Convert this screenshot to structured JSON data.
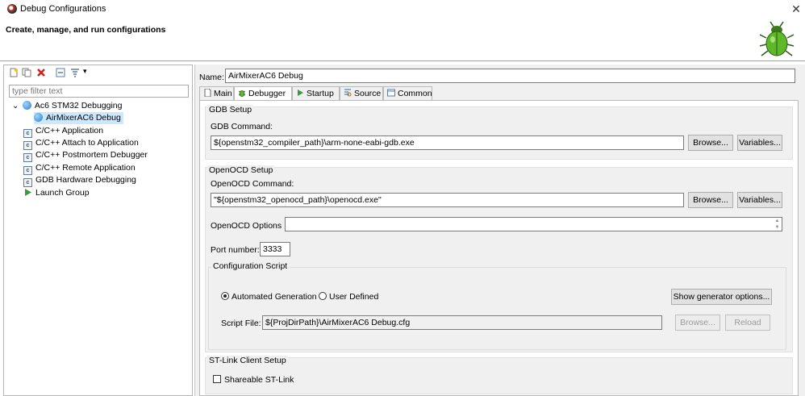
{
  "window": {
    "title": "Debug Configurations",
    "close": "✕"
  },
  "header": {
    "description": "Create, manage, and run configurations"
  },
  "left": {
    "filter_placeholder": "type filter text",
    "tree": [
      {
        "label": "Ac6 STM32 Debugging",
        "icon": "globe-icon",
        "expanded": true
      },
      {
        "label": "AirMixerAC6 Debug",
        "icon": "globe-icon",
        "selected": true
      },
      {
        "label": "C/C++ Application",
        "icon": "c-icon"
      },
      {
        "label": "C/C++ Attach to Application",
        "icon": "c-icon"
      },
      {
        "label": "C/C++ Postmortem Debugger",
        "icon": "c-icon"
      },
      {
        "label": "C/C++ Remote Application",
        "icon": "c-icon"
      },
      {
        "label": "GDB Hardware Debugging",
        "icon": "c-icon"
      },
      {
        "label": "Launch Group",
        "icon": "play-icon"
      }
    ],
    "expand_glyph": "⌄",
    "dropdown_glyph": "▾"
  },
  "right": {
    "name_label": "Name:",
    "name_value": "AirMixerAC6 Debug",
    "tabs": [
      "Main",
      "Debugger",
      "Startup",
      "Source",
      "Common"
    ],
    "active_tab": "Debugger",
    "gdb": {
      "group_title": "GDB Setup",
      "command_label": "GDB Command:",
      "command_value": "${openstm32_compiler_path}\\arm-none-eabi-gdb.exe",
      "browse": "Browse...",
      "variables": "Variables..."
    },
    "openocd": {
      "group_title": "OpenOCD Setup",
      "command_label": "OpenOCD Command:",
      "command_value": "\"${openstm32_openocd_path}\\openocd.exe\"",
      "browse": "Browse...",
      "variables": "Variables...",
      "options_label": "OpenOCD Options :",
      "options_value": "",
      "port_label": "Port number:",
      "port_value": "3333",
      "config_title": "Configuration Script",
      "auto_label": "Automated Generation",
      "user_label": "User Defined",
      "show_options": "Show generator options...",
      "script_label": "Script File:",
      "script_value": "${ProjDirPath}\\AirMixerAC6 Debug.cfg",
      "script_browse": "Browse...",
      "reload": "Reload"
    },
    "stlink": {
      "group_title": "ST-Link Client Setup",
      "shareable_label": "Shareable ST-Link"
    }
  },
  "colors": {
    "selection": "#cce8ff",
    "panel": "#f0f0f0",
    "button": "#e1e1e1"
  }
}
